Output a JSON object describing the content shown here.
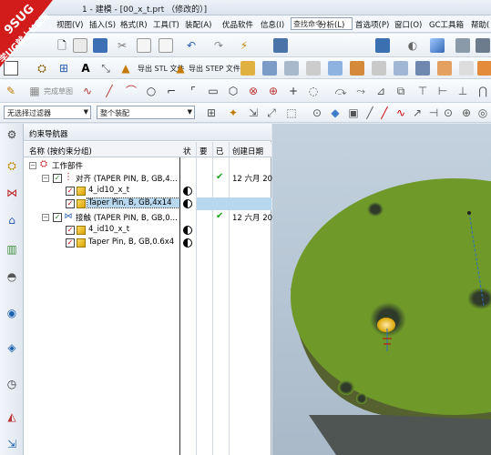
{
  "window": {
    "title": "1 - 建模 - [00_x_t.prt （修改的）]"
  },
  "watermark": {
    "line1": "9SUG",
    "line2": "学UG就上UG网"
  },
  "menu": {
    "items": [
      "视图(V)",
      "插入(S)",
      "格式(R)",
      "工具(T)",
      "装配(A)",
      "优品软件",
      "信息(I)",
      "分析(L)",
      "首选项(P)",
      "窗口(O)",
      "GC工具箱",
      "帮助("
    ]
  },
  "search": {
    "placeholder": "查找命令"
  },
  "toolbar2": {
    "export_stl": "导出 STL 文件",
    "export_step": "导出 STEP 文件"
  },
  "toolbar3": {
    "sketch_plane": "完成草图"
  },
  "filter_bar": {
    "selection_filter": "无选择过滤器",
    "assembly_scope": "整个装配"
  },
  "navigator": {
    "title": "约束导航器",
    "columns": {
      "name": "名称 (按约束分组)",
      "state": "状",
      "required": "要",
      "applied": "已",
      "created": "创建日期"
    },
    "rows": [
      {
        "name": "工作部件",
        "date": ""
      },
      {
        "name": "对齐 (TAPER PIN, B, GB,4...",
        "date": "12 六月 20"
      },
      {
        "name": "4_id10_x_t",
        "date": ""
      },
      {
        "name": "Taper Pin, B, GB,4x14",
        "date": ""
      },
      {
        "name": "接触 (TAPER PIN, B, GB,0...",
        "date": "12 六月 20"
      },
      {
        "name": "4_id10_x_t",
        "date": ""
      },
      {
        "name": "Taper Pin, B, GB,0.6x4",
        "date": ""
      }
    ]
  },
  "colors": {
    "model_green": "#6f9a2a",
    "model_dark": "#4e5552",
    "selection": "#b8d8f0"
  }
}
